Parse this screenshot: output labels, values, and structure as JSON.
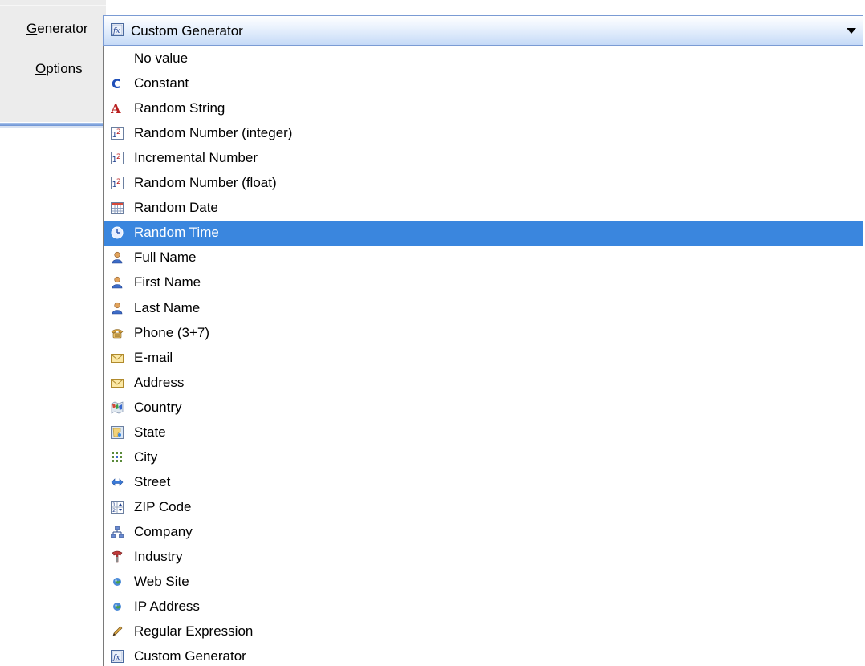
{
  "labels": {
    "generator": "Generator",
    "options": "Options"
  },
  "combo": {
    "selected": "Custom Generator",
    "icon": "custom-generator-icon"
  },
  "options": [
    {
      "label": "No value",
      "icon": ""
    },
    {
      "label": "Constant",
      "icon": "constant-icon"
    },
    {
      "label": "Random String",
      "icon": "string-icon"
    },
    {
      "label": "Random Number (integer)",
      "icon": "number-icon"
    },
    {
      "label": "Incremental Number",
      "icon": "number-icon"
    },
    {
      "label": "Random Number (float)",
      "icon": "number-icon"
    },
    {
      "label": "Random Date",
      "icon": "calendar-icon"
    },
    {
      "label": "Random Time",
      "icon": "clock-icon",
      "selected": true
    },
    {
      "label": "Full Name",
      "icon": "person-icon"
    },
    {
      "label": "First Name",
      "icon": "person-icon"
    },
    {
      "label": "Last Name",
      "icon": "person-icon"
    },
    {
      "label": "Phone (3+7)",
      "icon": "phone-icon"
    },
    {
      "label": "E-mail",
      "icon": "envelope-icon"
    },
    {
      "label": "Address",
      "icon": "envelope-icon"
    },
    {
      "label": "Country",
      "icon": "map-icon"
    },
    {
      "label": "State",
      "icon": "state-icon"
    },
    {
      "label": "City",
      "icon": "city-icon"
    },
    {
      "label": "Street",
      "icon": "street-icon"
    },
    {
      "label": "ZIP Code",
      "icon": "zip-icon"
    },
    {
      "label": "Company",
      "icon": "company-icon"
    },
    {
      "label": "Industry",
      "icon": "industry-icon"
    },
    {
      "label": "Web Site",
      "icon": "globe-icon"
    },
    {
      "label": "IP Address",
      "icon": "globe-icon"
    },
    {
      "label": "Regular Expression",
      "icon": "pencil-icon"
    },
    {
      "label": "Custom Generator",
      "icon": "custom-generator-icon"
    }
  ],
  "colors": {
    "selection": "#3a86de",
    "combo_border": "#7a9bd4"
  }
}
